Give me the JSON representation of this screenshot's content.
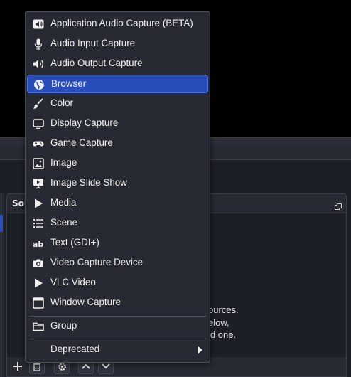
{
  "sources_dock": {
    "title": "Sou",
    "empty_hint": [
      "ources.",
      "elow,",
      "ld one."
    ]
  },
  "menu": {
    "items": [
      {
        "label": "Application Audio Capture (BETA)",
        "icon": "speaker-box-icon"
      },
      {
        "label": "Audio Input Capture",
        "icon": "microphone-icon"
      },
      {
        "label": "Audio Output Capture",
        "icon": "speaker-icon"
      },
      {
        "label": "Browser",
        "icon": "globe-icon",
        "highlighted": true
      },
      {
        "label": "Color",
        "icon": "brush-icon"
      },
      {
        "label": "Display Capture",
        "icon": "monitor-icon"
      },
      {
        "label": "Game Capture",
        "icon": "gamepad-icon"
      },
      {
        "label": "Image",
        "icon": "image-icon"
      },
      {
        "label": "Image Slide Show",
        "icon": "slideshow-icon"
      },
      {
        "label": "Media",
        "icon": "play-icon"
      },
      {
        "label": "Scene",
        "icon": "list-icon"
      },
      {
        "label": "Text (GDI+)",
        "icon": "text-icon"
      },
      {
        "label": "Video Capture Device",
        "icon": "camera-icon"
      },
      {
        "label": "VLC Video",
        "icon": "play-icon"
      },
      {
        "label": "Window Capture",
        "icon": "window-icon"
      }
    ],
    "group": {
      "label": "Group",
      "icon": "folder-icon"
    },
    "deprecated": {
      "label": "Deprecated",
      "icon": "chevron-right-icon"
    }
  },
  "colors": {
    "menu_bg": "#272a33",
    "highlight": "#284cb8",
    "highlight_border": "#4f74e3",
    "text": "#f0f0f0",
    "preview_bg": "#000000"
  }
}
